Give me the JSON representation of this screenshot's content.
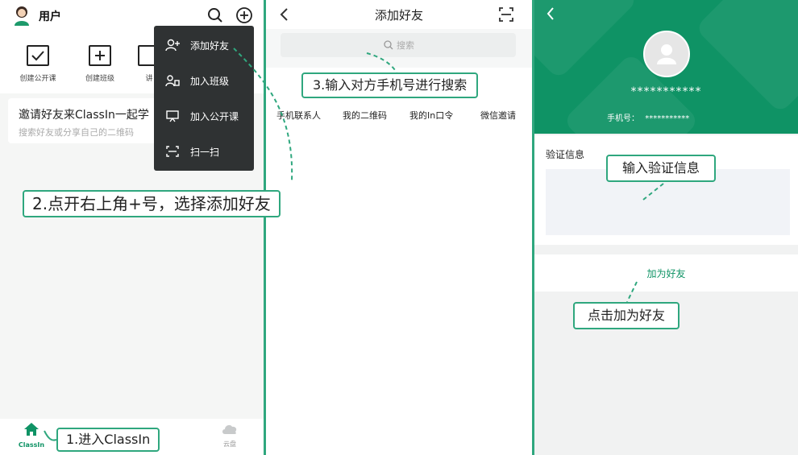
{
  "panel1": {
    "username": "用户",
    "quick_actions": [
      "创建公开课",
      "创建班级",
      "讲"
    ],
    "invite": {
      "title": "邀请好友来ClassIn一起学",
      "subtitle": "搜索好友或分享自己的二维码"
    },
    "menu": [
      {
        "label": "添加好友",
        "icon": "add-user-icon"
      },
      {
        "label": "加入班级",
        "icon": "group-icon"
      },
      {
        "label": "加入公开课",
        "icon": "presentation-icon"
      },
      {
        "label": "扫一扫",
        "icon": "scan-icon"
      }
    ],
    "bottom_nav": [
      {
        "label": "ClassIn",
        "icon": "home-icon",
        "active": true
      },
      {
        "label": "云盘",
        "icon": "cloud-icon",
        "active": false
      }
    ],
    "callouts": {
      "step1": "1.进入ClassIn",
      "step2": "2.点开右上角+号，选择添加好友"
    }
  },
  "panel2": {
    "title": "添加好友",
    "search_placeholder": "搜索",
    "tabs": [
      "手机联系人",
      "我的二维码",
      "我的In口令",
      "微信邀请"
    ],
    "callout": "3.输入对方手机号进行搜索"
  },
  "panel3": {
    "name": "***********",
    "phone_label": "手机号：",
    "phone_value": "***********",
    "verify_label": "验证信息",
    "add_button": "加为好友",
    "callouts": {
      "verify": "输入验证信息",
      "add": "点击加为好友"
    }
  },
  "colors": {
    "accent": "#2fa77e",
    "header_green": "#0f9365",
    "menu_bg": "#2f3233"
  }
}
